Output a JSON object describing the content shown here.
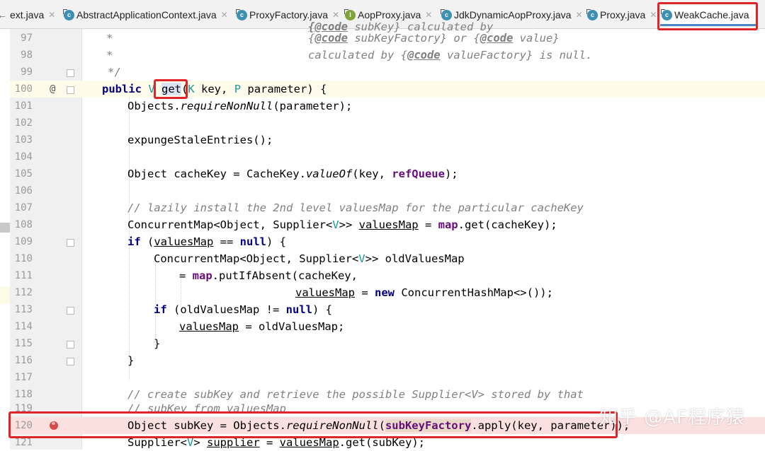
{
  "tabs": [
    {
      "label": "ext.java",
      "icon": "arrow-icon"
    },
    {
      "label": "AbstractApplicationContext.java",
      "icon": "class-icon"
    },
    {
      "label": "ProxyFactory.java",
      "icon": "class-icon"
    },
    {
      "label": "AopProxy.java",
      "icon": "interface-icon"
    },
    {
      "label": "JdkDynamicAopProxy.java",
      "icon": "class-icon"
    },
    {
      "label": "Proxy.java",
      "icon": "class-icon"
    },
    {
      "label": "WeakCache.java",
      "icon": "class-icon",
      "active": true
    }
  ],
  "lines": {
    "l96": {
      "num": "97",
      "t1": "* ",
      "t2": "{@code",
      "t3": " subKey} calculated by"
    },
    "l97": {
      "num": "97",
      "a": "*",
      "b": "{",
      "c": "@code",
      "d": " subKeyFactory} or {",
      "e": "@code",
      "f": " value}"
    },
    "l98": {
      "num": "98",
      "a": "*",
      "b": "calculated by {",
      "c": "@code",
      "d": " valueFactory} is null."
    },
    "l99": {
      "num": "99",
      "a": "*/"
    },
    "l100": {
      "num": "100",
      "a": "public ",
      "b": "V ",
      "c": "get",
      "d": "(",
      "e": "K",
      "f": " key, ",
      "g": "P",
      "h": " parameter) {"
    },
    "l101": {
      "num": "101",
      "a": "Objects.",
      "b": "requireNonNull",
      "c": "(parameter);"
    },
    "l102": {
      "num": "102"
    },
    "l103": {
      "num": "103",
      "a": "expungeStaleEntries();"
    },
    "l104": {
      "num": "104"
    },
    "l105": {
      "num": "105",
      "a": "Object cacheKey = CacheKey.",
      "b": "valueOf",
      "c": "(key, ",
      "d": "refQueue",
      "e": ");"
    },
    "l106": {
      "num": "106"
    },
    "l107": {
      "num": "107",
      "a": "// lazily install the 2nd level valuesMap for the particular cacheKey"
    },
    "l108": {
      "num": "108",
      "a": "ConcurrentMap<Object, Supplier<",
      "b": "V",
      "c": ">> ",
      "d": "valuesMap",
      "e": " = ",
      "f": "map",
      "g": ".get(cacheKey);"
    },
    "l109": {
      "num": "109",
      "a": "if",
      "b": " (",
      "c": "valuesMap",
      "d": " == ",
      "e": "null",
      "f": ") {"
    },
    "l110": {
      "num": "110",
      "a": "ConcurrentMap<Object, Supplier<",
      "b": "V",
      "c": ">> oldValuesMap"
    },
    "l111": {
      "num": "111",
      "a": "= ",
      "b": "map",
      "c": ".putIfAbsent(cacheKey,"
    },
    "l112": {
      "num": "112",
      "a": "valuesMap",
      "b": " = ",
      "c": "new",
      "d": " ConcurrentHashMap<>());"
    },
    "l113": {
      "num": "113",
      "a": "if",
      "b": " (oldValuesMap != ",
      "c": "null",
      "d": ") {"
    },
    "l114": {
      "num": "114",
      "a": "valuesMap",
      "b": " = oldValuesMap;"
    },
    "l115": {
      "num": "115",
      "a": "}"
    },
    "l116": {
      "num": "116",
      "a": "}"
    },
    "l117": {
      "num": "117"
    },
    "l118": {
      "num": "118",
      "a": "// create subKey and retrieve the possible Supplier<V> stored by that"
    },
    "l119": {
      "num": "119",
      "a": "// subKey from valuesMap"
    },
    "l120": {
      "num": "120",
      "a": "Object subKey = Objects.",
      "b": "requireNonNull",
      "c": "(",
      "d": "subKeyFactory",
      "e": ".apply(key, parameter));"
    },
    "l121": {
      "num": "121",
      "a": "Supplier<",
      "b": "V",
      "c": "> ",
      "d": "supplier",
      "e": " = ",
      "f": "valuesMap",
      "g": ".get(subKey);"
    }
  },
  "gutter_icons": {
    "override": "@",
    "breakpoint": "breakpoint-icon"
  },
  "watermark": "知乎 @AF程序猿",
  "colors": {
    "keyword": "#000080",
    "type_param": "#20999d",
    "field": "#660e7a",
    "comment": "#808080",
    "highlight_box": "#e0252a",
    "tab_underline": "#4a88c7"
  }
}
